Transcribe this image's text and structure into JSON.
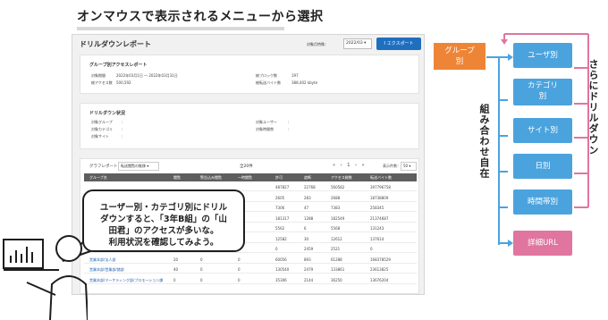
{
  "heading": "オンマウスで表示されるメニューから選択",
  "report": {
    "title": "ドリルダウンレポート",
    "period_label": "対象月特殊：",
    "period_value": "2022/03",
    "export_label": "エクスポート"
  },
  "group_access": {
    "title": "グループ別アクセスレポート",
    "fields": [
      {
        "label": "対象期間",
        "value": "2022年03月1日 ～ 2022年03月31日"
      },
      {
        "label": "総アクセス数",
        "value": "500,592"
      },
      {
        "label": "総ブロック数",
        "value": "197"
      },
      {
        "label": "総転送バイト数",
        "value": "388,402 kbyte"
      }
    ]
  },
  "drill_status": {
    "title": "ドリルダウン状況",
    "fields": [
      {
        "label": "対象グループ",
        "value": ":"
      },
      {
        "label": "対象カテゴリ",
        "value": ":"
      },
      {
        "label": "対象サイト",
        "value": ":"
      },
      {
        "label": "対象ユーザー",
        "value": ":"
      },
      {
        "label": "対象時間帯",
        "value": ":"
      }
    ]
  },
  "table": {
    "control_label": "グラフレポート：",
    "control_select": "転送閲覧の推移",
    "count": "全20件",
    "pager": "« ‹ 1 › »",
    "pagesize_label": "表示件数：",
    "pagesize": "50",
    "headers": [
      "グループ名",
      "閲覧",
      "警告込み閲覧",
      "一時閲覧",
      "許可",
      "遮断",
      "アクセス総数",
      "転送バイト数"
    ],
    "rows": [
      [
        "",
        "",
        "",
        "",
        "487827",
        "22768",
        "560582",
        "397796758"
      ],
      [
        "",
        "",
        "",
        "",
        "2605",
        "283",
        "2688",
        "18738809"
      ],
      [
        "",
        "",
        "",
        "",
        "7306",
        "47",
        "7383",
        "258345"
      ],
      [
        "",
        "",
        "",
        "",
        "181317",
        "1288",
        "182549",
        "21374687"
      ],
      [
        "",
        "",
        "",
        "",
        "5562",
        "6",
        "5568",
        "131243"
      ],
      [
        "",
        "",
        "",
        "",
        "12582",
        "30",
        "12612",
        "137614"
      ],
      [
        "",
        "",
        "",
        "",
        "0",
        "2459",
        "2521",
        "0"
      ],
      [
        "営業本部/法人部",
        "20",
        "0",
        "0",
        "60056",
        "893",
        "61288",
        "168378529"
      ],
      [
        "営業本部/営業部/諸部",
        "40",
        "0",
        "0",
        "130540",
        "2479",
        "133861",
        "23613825"
      ],
      [
        "営業本部/マーケティング部/プロモーション課",
        "0",
        "0",
        "0",
        "35306",
        "2144",
        "36250",
        "13676204"
      ]
    ]
  },
  "bubble": {
    "lines": [
      "ユーザー別・カテゴリ別にドリル",
      "ダウンすると、「3年B組」の「山",
      "田君」のアクセスが多いな。",
      "利用状況を確認してみよう。"
    ]
  },
  "flow": {
    "group": "グループ\n別",
    "items": [
      "ユーザ別",
      "カテゴリ\n別",
      "サイト別",
      "日別",
      "時間帯別",
      "詳細URL"
    ],
    "side_left": "組み合わせ自在",
    "side_right": "さらにドリルダウン",
    "colors": {
      "blue": "#4ba3de",
      "pink": "#e0759f",
      "orange": "#ee8536"
    }
  }
}
